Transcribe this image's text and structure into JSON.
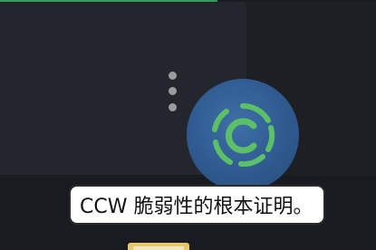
{
  "caption": {
    "text": "CCW 脆弱性的根本证明。"
  },
  "menu": {
    "icon": "more-vertical-icon"
  },
  "logo": {
    "icon": "ccw-logo-icon",
    "colors": {
      "circle": "#2f5a8f",
      "arc": "#5cc069",
      "inner_c": "#5cc069"
    }
  },
  "colors": {
    "background": "#1a1b20",
    "panel": "#24262e",
    "accent_bar": "#2f9e5a",
    "bottom_tab": "#e8c76a"
  }
}
